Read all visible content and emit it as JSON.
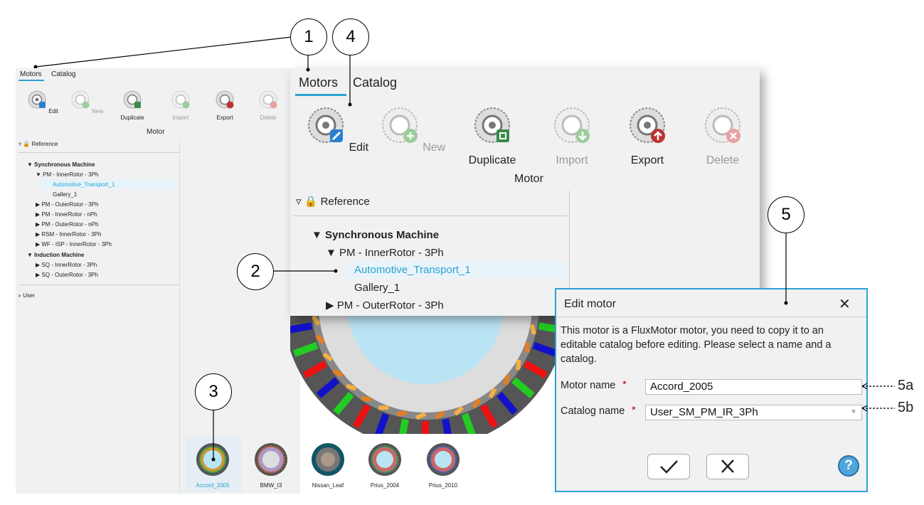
{
  "callouts": {
    "c1": "1",
    "c2": "2",
    "c3": "3",
    "c4": "4",
    "c5": "5",
    "c5a": "5a",
    "c5b": "5b"
  },
  "small": {
    "tabs": [
      "Motors",
      "Catalog"
    ],
    "toolbar": [
      "Edit",
      "New",
      "Duplicate",
      "Import",
      "Export",
      "Delete"
    ],
    "group_label": "Motor",
    "reference": "Reference",
    "tree": [
      "Synchronous Machine",
      "PM - InnerRotor - 3Ph",
      "Automotive_Transport_1",
      "Gallery_1",
      "PM - OuterRotor - 3Ph",
      "PM - InnerRotor - nPh",
      "PM - OuterRotor - nPh",
      "RSM - InnerRotor - 3Ph",
      "WF - ISP - InnerRotor - 3Ph",
      "Induction Machine",
      "SQ - InnerRotor - 3Ph",
      "SQ - OuterRotor - 3Ph"
    ],
    "user": "User"
  },
  "big": {
    "tabs": [
      "Motors",
      "Catalog"
    ],
    "toolbar": [
      "Edit",
      "New",
      "Duplicate",
      "Import",
      "Export",
      "Delete"
    ],
    "group_label": "Motor",
    "reference": "Reference",
    "tree": [
      "Synchronous Machine",
      "PM - InnerRotor - 3Ph",
      "Automotive_Transport_1",
      "Gallery_1",
      "PM - OuterRotor - 3Ph"
    ]
  },
  "gallery": [
    "Accord_2005",
    "BMW_I3",
    "Nissan_Leaf",
    "Prius_2004",
    "Prius_2010"
  ],
  "dialog": {
    "title": "Edit motor",
    "close": "✕",
    "message": "This motor is a FluxMotor motor, you need to copy it to an editable catalog before editing. Please select a name and a catalog.",
    "motor_name_label": "Motor name",
    "motor_name_value": "Accord_2005",
    "catalog_name_label": "Catalog name",
    "catalog_name_value": "User_SM_PM_IR_3Ph",
    "required_mark": "*",
    "help": "?"
  },
  "colors": {
    "accent": "#2aa1d3",
    "selected_text": "#2aa1d3",
    "required": "#c00000"
  },
  "icons": [
    "edit-icon",
    "new-icon",
    "duplicate-icon",
    "import-icon",
    "export-icon",
    "delete-icon",
    "lock-icon",
    "check-icon",
    "cancel-icon",
    "help-icon",
    "close-icon"
  ]
}
